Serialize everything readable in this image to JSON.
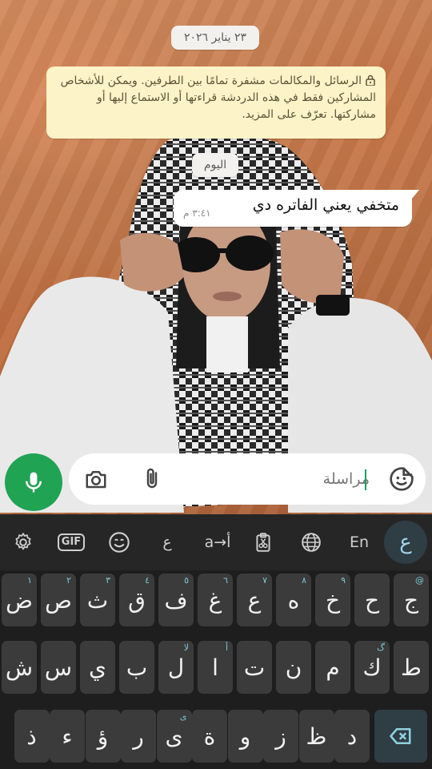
{
  "chat": {
    "date_chip": "٢٣ يناير ٢٠٢٦",
    "encryption_notice": "الرسائل والمكالمات مشفرة تمامًا بين الطرفين. ويمكن للأشخاص المشاركين فقط في هذه الدردشة قراءتها أو الاستماع إليها أو مشاركتها. تعرّف على المزيد.",
    "today_chip": "اليوم",
    "messages": [
      {
        "text": "متخفي يعني الفاتره دي",
        "time": "٣:٤١ م",
        "direction": "incoming"
      }
    ]
  },
  "composer": {
    "value": "مراسلة",
    "icons": [
      "mic-icon",
      "camera-icon",
      "paperclip-icon",
      "sticker-icon"
    ],
    "accent": "#21a354"
  },
  "keyboard": {
    "toolbar": {
      "gif": "GIF",
      "ain": "ع",
      "translit": "a→أ",
      "en": "En",
      "lang_active": "ع"
    },
    "row1": [
      {
        "k": "ج",
        "h": "@"
      },
      {
        "k": "ح",
        "h": ""
      },
      {
        "k": "خ",
        "h": "٩"
      },
      {
        "k": "ه",
        "h": "٨"
      },
      {
        "k": "ع",
        "h": "٧"
      },
      {
        "k": "غ",
        "h": "٦"
      },
      {
        "k": "ف",
        "h": "٥"
      },
      {
        "k": "ق",
        "h": "٤"
      },
      {
        "k": "ث",
        "h": "٣"
      },
      {
        "k": "ص",
        "h": "٢"
      },
      {
        "k": "ض",
        "h": "١"
      }
    ],
    "row2": [
      {
        "k": "ط",
        "h": ""
      },
      {
        "k": "ك",
        "h": "گ"
      },
      {
        "k": "م",
        "h": ""
      },
      {
        "k": "ن",
        "h": ""
      },
      {
        "k": "ت",
        "h": ""
      },
      {
        "k": "ا",
        "h": "أ"
      },
      {
        "k": "ل",
        "h": "لا"
      },
      {
        "k": "ب",
        "h": ""
      },
      {
        "k": "ي",
        "h": ""
      },
      {
        "k": "س",
        "h": ""
      },
      {
        "k": "ش",
        "h": ""
      }
    ],
    "row3": [
      {
        "k": "د",
        "h": ""
      },
      {
        "k": "ظ",
        "h": ""
      },
      {
        "k": "ز",
        "h": ""
      },
      {
        "k": "و",
        "h": ""
      },
      {
        "k": "ة",
        "h": ""
      },
      {
        "k": "ى",
        "h": "ى"
      },
      {
        "k": "ر",
        "h": ""
      },
      {
        "k": "ؤ",
        "h": ""
      },
      {
        "k": "ء",
        "h": ""
      },
      {
        "k": "ذ",
        "h": ""
      }
    ]
  }
}
